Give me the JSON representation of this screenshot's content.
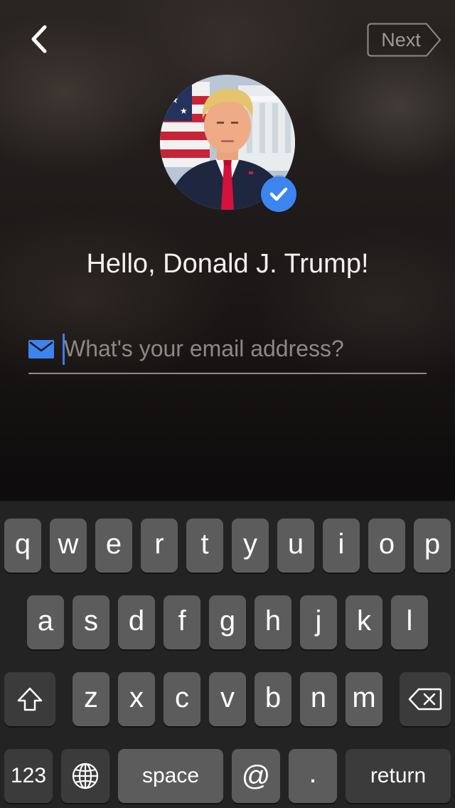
{
  "header": {
    "back_icon": "chevron-left-icon",
    "next_label": "Next"
  },
  "profile": {
    "avatar_icon": "profile-photo",
    "verified_icon": "check-badge-icon",
    "greeting": "Hello, Donald J. Trump!"
  },
  "email": {
    "icon": "mail-icon",
    "placeholder": "What's your email address?",
    "value": ""
  },
  "keyboard": {
    "row1": [
      "q",
      "w",
      "e",
      "r",
      "t",
      "y",
      "u",
      "i",
      "o",
      "p"
    ],
    "row2": [
      "a",
      "s",
      "d",
      "f",
      "g",
      "h",
      "j",
      "k",
      "l"
    ],
    "row3": [
      "z",
      "x",
      "c",
      "v",
      "b",
      "n",
      "m"
    ],
    "shift_icon": "shift-icon",
    "delete_icon": "backspace-icon",
    "numbers_label": "123",
    "globe_icon": "globe-icon",
    "space_label": "space",
    "at_label": "@",
    "dot_label": ".",
    "return_label": "return"
  },
  "colors": {
    "accent": "#3c84f0",
    "key_light": "#5c5c5c",
    "key_dark": "#3b3b3b",
    "keyboard_bg": "#232323"
  }
}
